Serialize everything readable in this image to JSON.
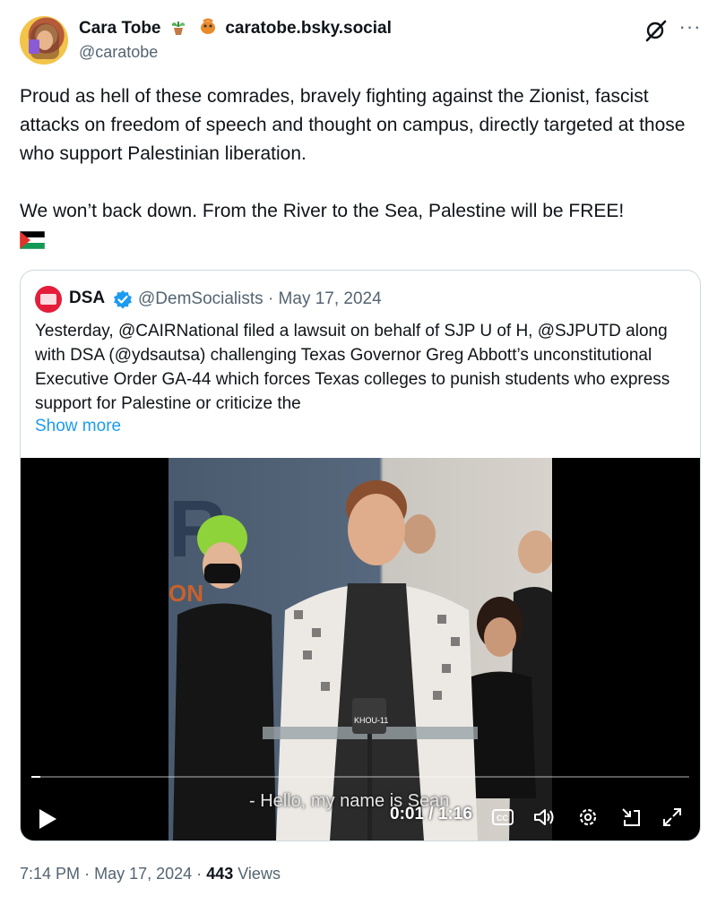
{
  "author": {
    "display_name": "Cara Tobe",
    "bsky": "caratobe.bsky.social",
    "handle": "@caratobe"
  },
  "tweet": {
    "paragraph1": "Proud as hell of these comrades, bravely fighting against the Zionist, fascist attacks on freedom of speech and thought on campus, directly targeted at those who support Palestinian liberation.",
    "paragraph2": "We won’t back down. From the River to the Sea, Palestine will be FREE!"
  },
  "quote": {
    "name": "DSA",
    "handle": "@DemSocialists",
    "separator": "·",
    "date": "May 17, 2024",
    "text": "Yesterday, @CAIRNational filed a lawsuit on behalf of SJP U of H, @SJPUTD along with DSA (@ydsautsa) challenging Texas Governor Greg Abbott’s unconstitutional Executive Order GA-44 which forces Texas colleges to punish students who express support for Palestine or criticize the",
    "show_more": "Show more"
  },
  "video": {
    "subtitle": "- Hello, my name is Sean",
    "time": "0:01 / 1:16",
    "progress": 0.013,
    "mic_label": "KHOU-11"
  },
  "footer": {
    "time": "7:14 PM",
    "dot1": "·",
    "date": "May 17, 2024",
    "dot2": "·",
    "views_count": "443",
    "views_label": "Views"
  },
  "colors": {
    "accent": "#1d9bf0",
    "muted": "#536471",
    "text": "#0f1419",
    "border": "#cfd9de"
  },
  "icons": [
    "grok-icon",
    "more-icon",
    "verified-icon",
    "play-icon",
    "captions-icon",
    "volume-icon",
    "settings-icon",
    "pip-icon",
    "fullscreen-icon",
    "palestine-flag-icon",
    "plant-emoji-icon",
    "butterfly-emoji-icon"
  ]
}
